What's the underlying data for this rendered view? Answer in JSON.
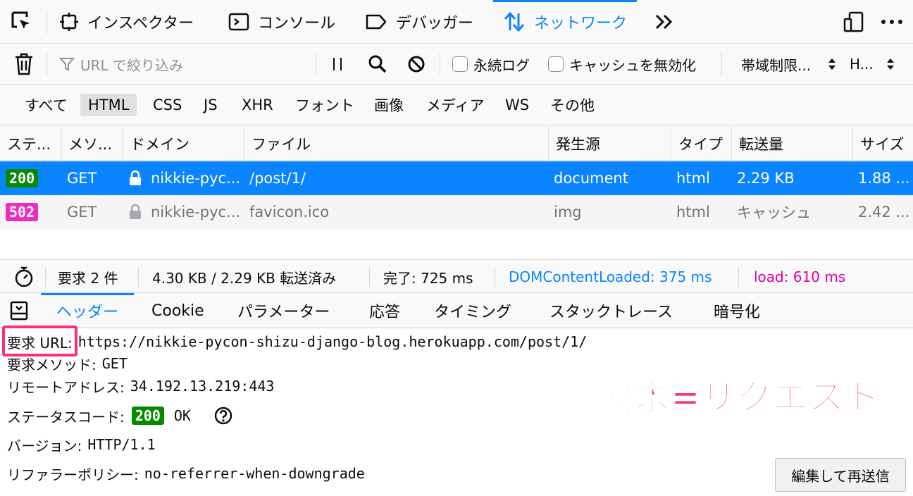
{
  "toolbar": {
    "tabs": [
      {
        "label": "インスペクター",
        "icon": "inspector-icon"
      },
      {
        "label": "コンソール",
        "icon": "console-icon"
      },
      {
        "label": "デバッガー",
        "icon": "debugger-icon"
      },
      {
        "label": "ネットワーク",
        "icon": "network-icon",
        "active": true
      }
    ],
    "more_icon": "chevron-double-right-icon",
    "accent": "#0a84ff"
  },
  "filter": {
    "url_placeholder": "URL で絞り込み",
    "persist_log": "永続ログ",
    "disable_cache": "キャッシュを無効化",
    "throttle": "帯域制限...",
    "har": "H..."
  },
  "types": [
    "すべて",
    "HTML",
    "CSS",
    "JS",
    "XHR",
    "フォント",
    "画像",
    "メディア",
    "WS",
    "その他"
  ],
  "columns": [
    "ステ...",
    "メソ...",
    "ドメイン",
    "ファイル",
    "発生源",
    "タイプ",
    "転送量",
    "サイズ"
  ],
  "rows": [
    {
      "status": "200",
      "status_color": "#058b00",
      "method": "GET",
      "domain": "nikkie-pyc...",
      "file": "/post/1/",
      "cause": "document",
      "type": "html",
      "transferred": "2.29 KB",
      "size": "1.88 ..."
    },
    {
      "status": "502",
      "status_color": "#ed2dc2",
      "method": "GET",
      "domain": "nikkie-pyc...",
      "file": "favicon.ico",
      "cause": "img",
      "type": "html",
      "transferred": "キャッシュ",
      "size": "2.42 ..."
    }
  ],
  "summary": {
    "requests": "要求 2 件",
    "transferred": "4.30 KB / 2.29 KB 転送済み",
    "finish": "完了: 725 ms",
    "dom": "DOMContentLoaded: 375 ms",
    "load": "load: 610 ms"
  },
  "detail_tabs": [
    "ヘッダー",
    "Cookie",
    "パラメーター",
    "応答",
    "タイミング",
    "スタックトレース",
    "暗号化"
  ],
  "details": {
    "url_label": "要求 URL:",
    "url_value": "https://nikkie-pycon-shizu-django-blog.herokuapp.com/post/1/",
    "method_label": "要求メソッド:",
    "method_value": "GET",
    "remote_label": "リモートアドレス:",
    "remote_value": "34.192.13.219:443",
    "status_label": "ステータスコード:",
    "status_code": "200",
    "status_text": "OK",
    "version_label": "バージョン:",
    "version_value": "HTTP/1.1",
    "referrer_label": "リファラーポリシー:",
    "referrer_value": "no-referrer-when-downgrade",
    "resend_button": "編集して再送信"
  },
  "annotation": {
    "text": "要求=リクエスト",
    "color": "#f23a7d"
  }
}
